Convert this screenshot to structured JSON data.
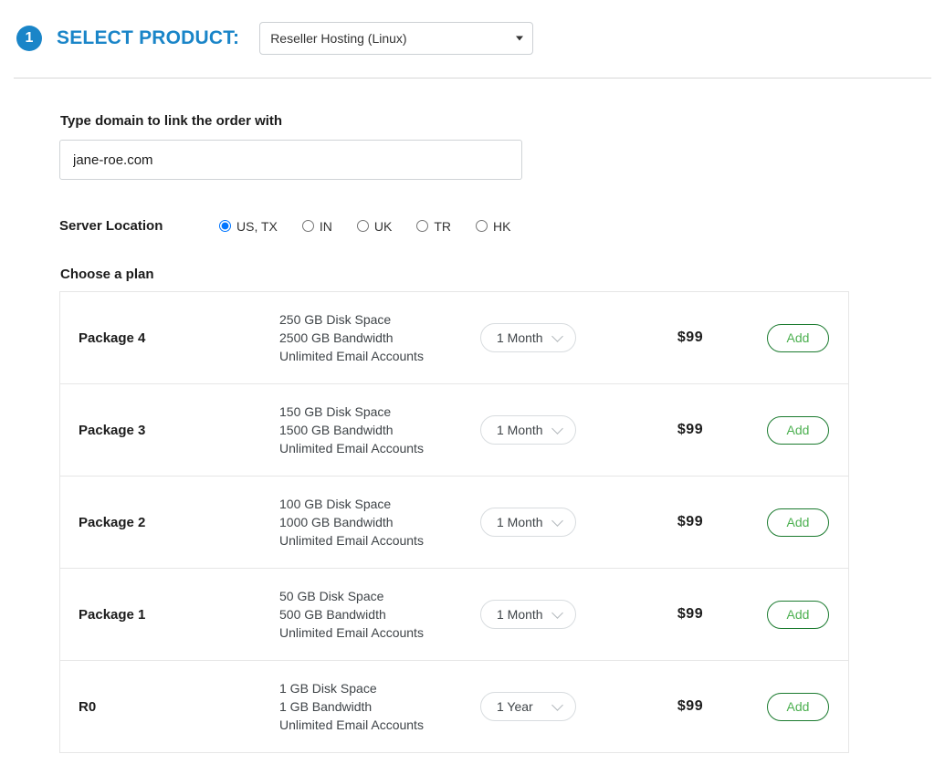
{
  "step": {
    "number": "1",
    "title": "SELECT PRODUCT:",
    "accent_color": "#1a85c8",
    "product_select": {
      "value": "Reseller Hosting (Linux)",
      "arrow_icon": "caret-down-icon"
    }
  },
  "domain": {
    "label": "Type domain to link the order with",
    "value": "jane-roe.com",
    "placeholder": ""
  },
  "server_location": {
    "label": "Server Location",
    "options": [
      {
        "label": "US, TX",
        "selected": true
      },
      {
        "label": "IN",
        "selected": false
      },
      {
        "label": "UK",
        "selected": false
      },
      {
        "label": "TR",
        "selected": false
      },
      {
        "label": "HK",
        "selected": false
      }
    ]
  },
  "plans": {
    "label": "Choose a plan",
    "add_label": "Add",
    "chevron_icon": "chevron-down-icon",
    "rows": [
      {
        "name": "Package 4",
        "disk": "250 GB Disk Space",
        "bandwidth": "2500 GB Bandwidth",
        "email": "Unlimited Email Accounts",
        "term": "1 Month",
        "price": "$99"
      },
      {
        "name": "Package 3",
        "disk": "150 GB Disk Space",
        "bandwidth": "1500 GB Bandwidth",
        "email": "Unlimited Email Accounts",
        "term": "1 Month",
        "price": "$99"
      },
      {
        "name": "Package 2",
        "disk": "100 GB Disk Space",
        "bandwidth": "1000 GB Bandwidth",
        "email": "Unlimited Email Accounts",
        "term": "1 Month",
        "price": "$99"
      },
      {
        "name": "Package 1",
        "disk": "50 GB Disk Space",
        "bandwidth": "500 GB Bandwidth",
        "email": "Unlimited Email Accounts",
        "term": "1 Month",
        "price": "$99"
      },
      {
        "name": "R0",
        "disk": "1 GB Disk Space",
        "bandwidth": "1 GB Bandwidth",
        "email": "Unlimited Email Accounts",
        "term": "1 Year",
        "price": "$99"
      }
    ]
  }
}
